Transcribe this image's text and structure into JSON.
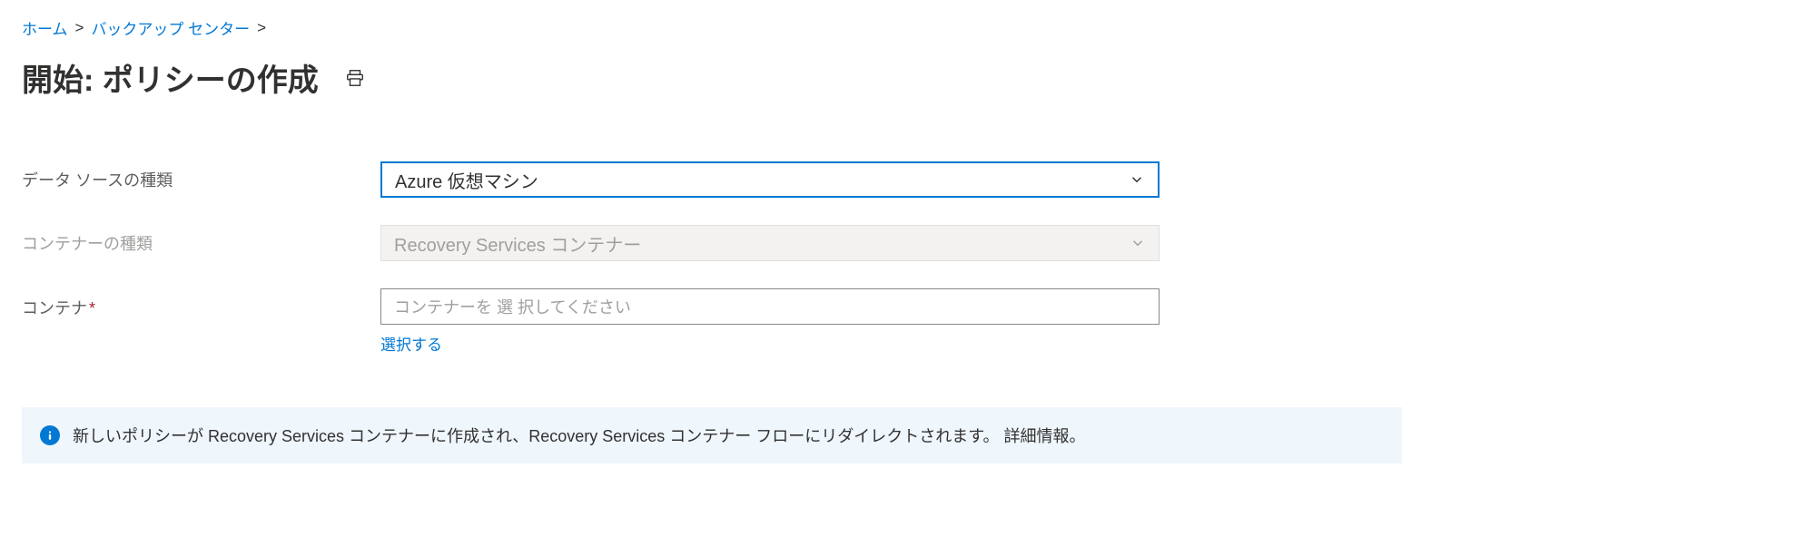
{
  "breadcrumb": {
    "home": "ホーム",
    "backup_center": "バックアップ センター"
  },
  "page_title": "開始: ポリシーの作成",
  "form": {
    "datasource_label": "データ ソースの種類",
    "datasource_value": "Azure 仮想マシン",
    "container_type_label": "コンテナーの種類",
    "container_type_value": "Recovery Services コンテナー",
    "container_label": "コンテナ",
    "container_placeholder": "コンテナーを 選 択してください",
    "select_link": "選択する"
  },
  "info_message": "新しいポリシーが Recovery Services コンテナーに作成され、Recovery Services コンテナー フローにリダイレクトされます。 詳細情報。"
}
